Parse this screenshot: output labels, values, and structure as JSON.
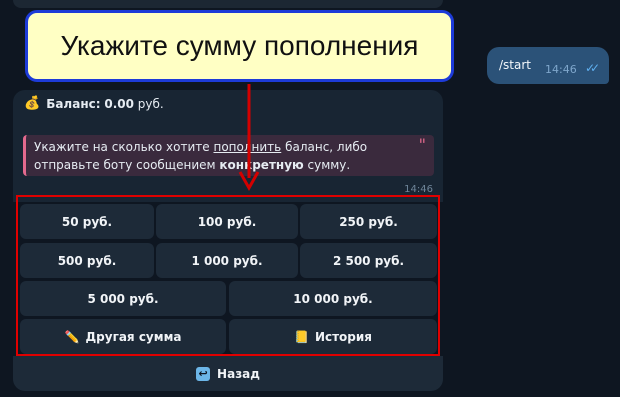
{
  "user_message": {
    "text": "/start",
    "time": "14:46"
  },
  "bot_message": {
    "balance_label": "Баланс:",
    "balance_value": "0.00",
    "balance_currency": "руб.",
    "quote_line1_a": "Укажите на сколько хотите ",
    "quote_line1_link": "пополнить",
    "quote_line1_b": " баланс, либо",
    "quote_line2_a": "отправьте боту сообщением ",
    "quote_line2_bold": "конкретную",
    "quote_line2_b": " сумму.",
    "time": "14:46"
  },
  "keyboard": {
    "row1": [
      "50 руб.",
      "100 руб.",
      "250 руб."
    ],
    "row2": [
      "500 руб.",
      "1 000 руб.",
      "2 500 руб."
    ],
    "row3": [
      "5 000 руб.",
      "10 000 руб."
    ],
    "other_amount": "Другая сумма",
    "history": "История",
    "back": "Назад"
  },
  "annotation": {
    "text": "Укажите сумму пополнения"
  },
  "colors": {
    "highlight": "#e00000",
    "annotation_border": "#1d3bd8",
    "annotation_bg": "#ffffc4"
  }
}
